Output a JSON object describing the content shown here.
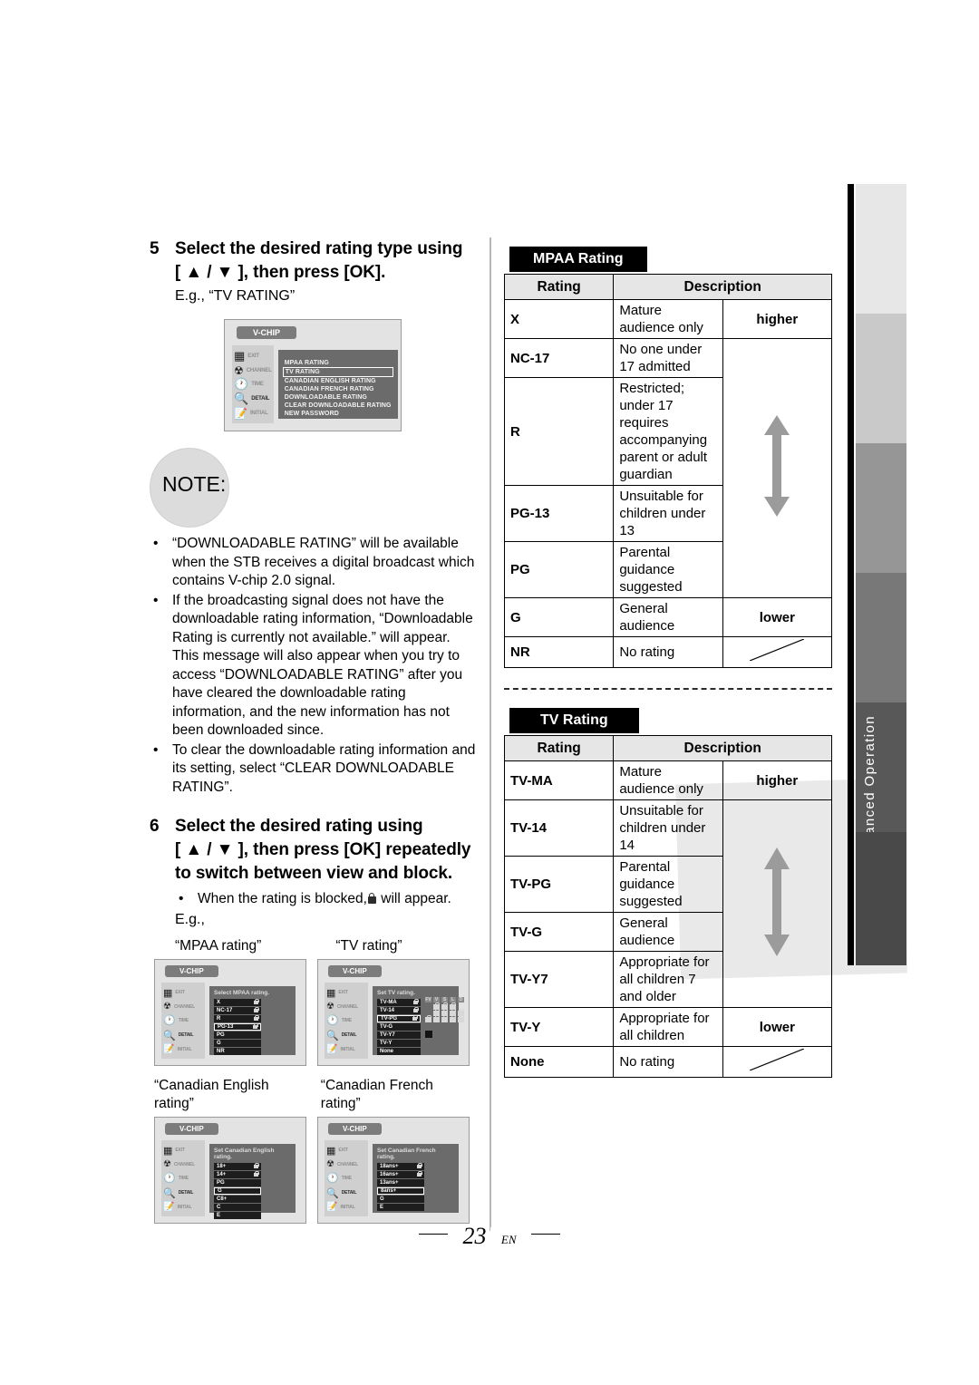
{
  "document": {
    "page_number": "23",
    "page_lang": "EN",
    "side_tab_label": "Advanced Operation"
  },
  "steps": [
    {
      "number": "5",
      "heading_line1": "Select the desired rating type using",
      "heading_line2": "[ ▲ / ▼ ], then press [OK].",
      "example": "E.g., “TV  RATING”"
    },
    {
      "number": "6",
      "heading_line1": "Select the desired rating using",
      "heading_line2": "[ ▲ / ▼ ], then press [OK] repeatedly",
      "heading_line3": "to switch between view and block.",
      "bullet": "When the rating is blocked,  will appear.",
      "bullet_pre": "When the rating is blocked,",
      "bullet_post": "will appear.",
      "example": "E.g.,"
    }
  ],
  "note": {
    "label": "NOTE:",
    "items": [
      "“DOWNLOADABLE RATING” will be available when the STB receives a digital broadcast which contains V-chip 2.0 signal.",
      "If the broadcasting signal does not have the downloadable rating information, “Downloadable Rating is currently not available.” will appear. This message will also appear when you try to access “DOWNLOADABLE RATING” after you have cleared the downloadable rating information, and the new information has not been downloaded since.",
      "To clear the downloadable rating information and its setting, select “CLEAR DOWNLOADABLE RATING”."
    ]
  },
  "osd_common": {
    "title": "V-CHIP",
    "sidebar": [
      {
        "icon": "exit-door-icon",
        "label": "EXIT"
      },
      {
        "icon": "setup-icon",
        "label": "CHANNEL"
      },
      {
        "icon": "clock-icon",
        "label": "TIME"
      },
      {
        "icon": "magnifier-icon",
        "label": "DETAIL"
      },
      {
        "icon": "notepad-icon",
        "label": "INITIAL"
      }
    ],
    "active_sidebar": "DETAIL"
  },
  "osd_menu": {
    "items": [
      "MPAA RATING",
      "TV RATING",
      "CANADIAN ENGLISH RATING",
      "CANADIAN FRENCH RATING",
      "DOWNLOADABLE RATING",
      "CLEAR DOWNLOADABLE RATING",
      "NEW PASSWORD"
    ],
    "selected": "TV RATING"
  },
  "screens": [
    {
      "caption": "“MPAA rating”",
      "prompt": "Select MPAA rating.",
      "rows": [
        {
          "label": "X",
          "locked": true,
          "selected": false
        },
        {
          "label": "NC-17",
          "locked": true,
          "selected": false
        },
        {
          "label": "R",
          "locked": true,
          "selected": false
        },
        {
          "label": "PG-13",
          "locked": true,
          "selected": true
        },
        {
          "label": "PG",
          "locked": false,
          "selected": false
        },
        {
          "label": "G",
          "locked": false,
          "selected": false
        },
        {
          "label": "NR",
          "locked": false,
          "selected": false
        }
      ],
      "grid_headers": [],
      "grid": []
    },
    {
      "caption": "“TV rating”",
      "prompt": "Set TV rating.",
      "rows": [
        {
          "label": "TV-MA",
          "locked": true,
          "selected": false
        },
        {
          "label": "TV-14",
          "locked": true,
          "selected": false
        },
        {
          "label": "TV-PG",
          "locked": true,
          "selected": true
        },
        {
          "label": "TV-G",
          "locked": false,
          "selected": false
        },
        {
          "label": "TV-Y7",
          "locked": false,
          "selected": false
        },
        {
          "label": "TV-Y",
          "locked": false,
          "selected": false
        },
        {
          "label": "None",
          "locked": false,
          "selected": false
        }
      ],
      "grid_headers": [
        "FV",
        "V",
        "S",
        "L",
        "D"
      ],
      "grid": [
        [
          false,
          true,
          true,
          true,
          false
        ],
        [
          false,
          true,
          true,
          true,
          true
        ],
        [
          true,
          true,
          true,
          true,
          true
        ]
      ]
    },
    {
      "caption": "“Canadian English rating”",
      "prompt": "Set Canadian English rating.",
      "rows": [
        {
          "label": "18+",
          "locked": true,
          "selected": false
        },
        {
          "label": "14+",
          "locked": true,
          "selected": false
        },
        {
          "label": "PG",
          "locked": false,
          "selected": false
        },
        {
          "label": "G",
          "locked": false,
          "selected": true
        },
        {
          "label": "C8+",
          "locked": false,
          "selected": false
        },
        {
          "label": "C",
          "locked": false,
          "selected": false
        },
        {
          "label": "E",
          "locked": false,
          "selected": false
        }
      ],
      "grid_headers": [],
      "grid": []
    },
    {
      "caption": "“Canadian French rating”",
      "prompt": "Set Canadian French rating.",
      "rows": [
        {
          "label": "18ans+",
          "locked": true,
          "selected": false
        },
        {
          "label": "16ans+",
          "locked": true,
          "selected": false
        },
        {
          "label": "13ans+",
          "locked": false,
          "selected": false
        },
        {
          "label": "8ans+",
          "locked": false,
          "selected": true
        },
        {
          "label": "G",
          "locked": false,
          "selected": false
        },
        {
          "label": "E",
          "locked": false,
          "selected": false
        }
      ],
      "grid_headers": [],
      "grid": []
    }
  ],
  "tables": [
    {
      "badge": "MPAA Rating",
      "headers": {
        "rating": "Rating",
        "description": "Description"
      },
      "scale_high": "higher",
      "scale_low": "lower",
      "rows": [
        {
          "code": "X",
          "desc": "Mature audience only"
        },
        {
          "code": "NC-17",
          "desc": "No one under 17 admitted"
        },
        {
          "code": "R",
          "desc": "Restricted; under 17 requires accompanying parent or adult guardian"
        },
        {
          "code": "PG-13",
          "desc": "Unsuitable for children under 13"
        },
        {
          "code": "PG",
          "desc": "Parental guidance suggested"
        },
        {
          "code": "G",
          "desc": "General audience"
        },
        {
          "code": "NR",
          "desc": "No rating"
        }
      ]
    },
    {
      "badge": "TV Rating",
      "headers": {
        "rating": "Rating",
        "description": "Description"
      },
      "scale_high": "higher",
      "scale_low": "lower",
      "rows": [
        {
          "code": "TV-MA",
          "desc": "Mature audience only"
        },
        {
          "code": "TV-14",
          "desc": "Unsuitable for children under 14"
        },
        {
          "code": "TV-PG",
          "desc": "Parental guidance suggested"
        },
        {
          "code": "TV-G",
          "desc": "General audience"
        },
        {
          "code": "TV-Y7",
          "desc": "Appropriate for all children 7 and older"
        },
        {
          "code": "TV-Y",
          "desc": "Appropriate for all children"
        },
        {
          "code": "None",
          "desc": "No rating"
        }
      ]
    }
  ],
  "side_bands": [
    {
      "shade": "#e7e7e7",
      "label": ""
    },
    {
      "shade": "#c9c9c9",
      "label": ""
    },
    {
      "shade": "#969696",
      "label": ""
    },
    {
      "shade": "#787878",
      "label": ""
    },
    {
      "shade": "#585858",
      "label": "Advanced Operation"
    },
    {
      "shade": "#494949",
      "label": ""
    }
  ]
}
